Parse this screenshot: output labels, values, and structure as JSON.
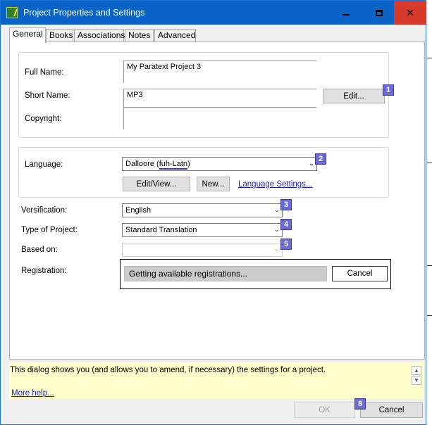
{
  "window": {
    "title": "Project Properties and Settings"
  },
  "tabs": [
    {
      "label": "General",
      "active": true
    },
    {
      "label": "Books"
    },
    {
      "label": "Associations"
    },
    {
      "label": "Notes"
    },
    {
      "label": "Advanced"
    }
  ],
  "general": {
    "full_name_label": "Full Name:",
    "full_name_value": "My Paratext Project 3",
    "short_name_label": "Short Name:",
    "short_name_value": "MP3",
    "edit_button": "Edit...",
    "copyright_label": "Copyright:",
    "copyright_value": "",
    "language_label": "Language:",
    "language_value_prefix": "Dalloore (",
    "language_value_code": "fuh-Latn",
    "language_value_suffix": ")",
    "edit_view_button": "Edit/View...",
    "new_button": "New...",
    "language_settings_link": "Language Settings...",
    "versification_label": "Versification:",
    "versification_value": "English",
    "type_label": "Type of Project:",
    "type_value": "Standard Translation",
    "based_on_label": "Based on:",
    "based_on_value": "",
    "registration_label": "Registration:",
    "registration_status": "Getting available registrations...",
    "registration_cancel": "Cancel"
  },
  "markers": [
    "1",
    "2",
    "3",
    "4",
    "5",
    "8"
  ],
  "help": {
    "text": "This dialog shows you (and allows you to amend, if necessary) the settings for a project.",
    "more_help": "More help..."
  },
  "footer": {
    "ok": "OK",
    "cancel": "Cancel"
  }
}
